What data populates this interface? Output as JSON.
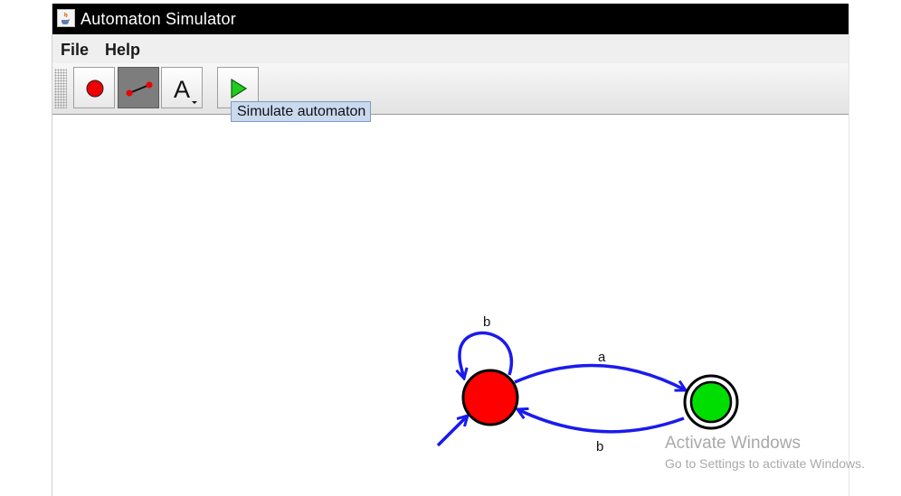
{
  "window": {
    "title": "Automaton Simulator"
  },
  "menu": {
    "items": [
      "File",
      "Help"
    ]
  },
  "toolbar": {
    "tools": [
      {
        "name": "add-state",
        "icon": "red-dot-icon",
        "selected": false
      },
      {
        "name": "add-transition",
        "icon": "transition-line-icon",
        "selected": true
      },
      {
        "name": "label",
        "icon": "letter-a-icon",
        "text": "A",
        "selected": false
      },
      {
        "name": "simulate",
        "icon": "play-icon",
        "selected": false
      }
    ],
    "tooltip": "Simulate automaton"
  },
  "automaton": {
    "states": [
      {
        "id": "q0",
        "initial": true,
        "accepting": false,
        "color": "#ff0000"
      },
      {
        "id": "q1",
        "initial": false,
        "accepting": true,
        "color": "#00dd00"
      }
    ],
    "transitions": [
      {
        "from": "q0",
        "to": "q0",
        "label": "b"
      },
      {
        "from": "q0",
        "to": "q1",
        "label": "a"
      },
      {
        "from": "q1",
        "to": "q0",
        "label": "b"
      }
    ],
    "edge_color": "#1a1aee"
  },
  "watermark": {
    "title": "Activate Windows",
    "subtitle": "Go to Settings to activate Windows."
  }
}
